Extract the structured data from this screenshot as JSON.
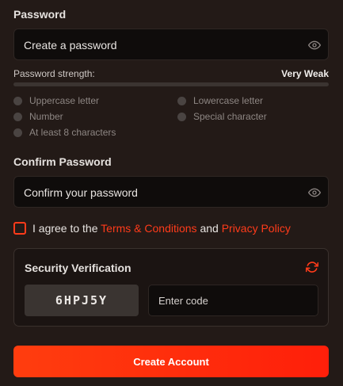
{
  "password": {
    "label": "Password",
    "placeholder": "Create a password",
    "strength_label": "Password strength:",
    "strength_value": "Very Weak",
    "strength_percent": 0,
    "strength_color": "#ff3b1a",
    "requirements": [
      {
        "label": "Uppercase letter",
        "met": false
      },
      {
        "label": "Lowercase letter",
        "met": false
      },
      {
        "label": "Number",
        "met": false
      },
      {
        "label": "Special character",
        "met": false
      },
      {
        "label": "At least 8 characters",
        "met": false
      }
    ]
  },
  "confirm": {
    "label": "Confirm Password",
    "placeholder": "Confirm your password"
  },
  "terms": {
    "checked": false,
    "prefix": "I agree to the",
    "terms_link": "Terms & Conditions",
    "and": "and",
    "privacy_link": "Privacy Policy"
  },
  "security": {
    "title": "Security Verification",
    "captcha": "6HPJ5Y",
    "code_placeholder": "Enter code"
  },
  "submit_label": "Create Account",
  "accent_color": "#ff3b1a"
}
